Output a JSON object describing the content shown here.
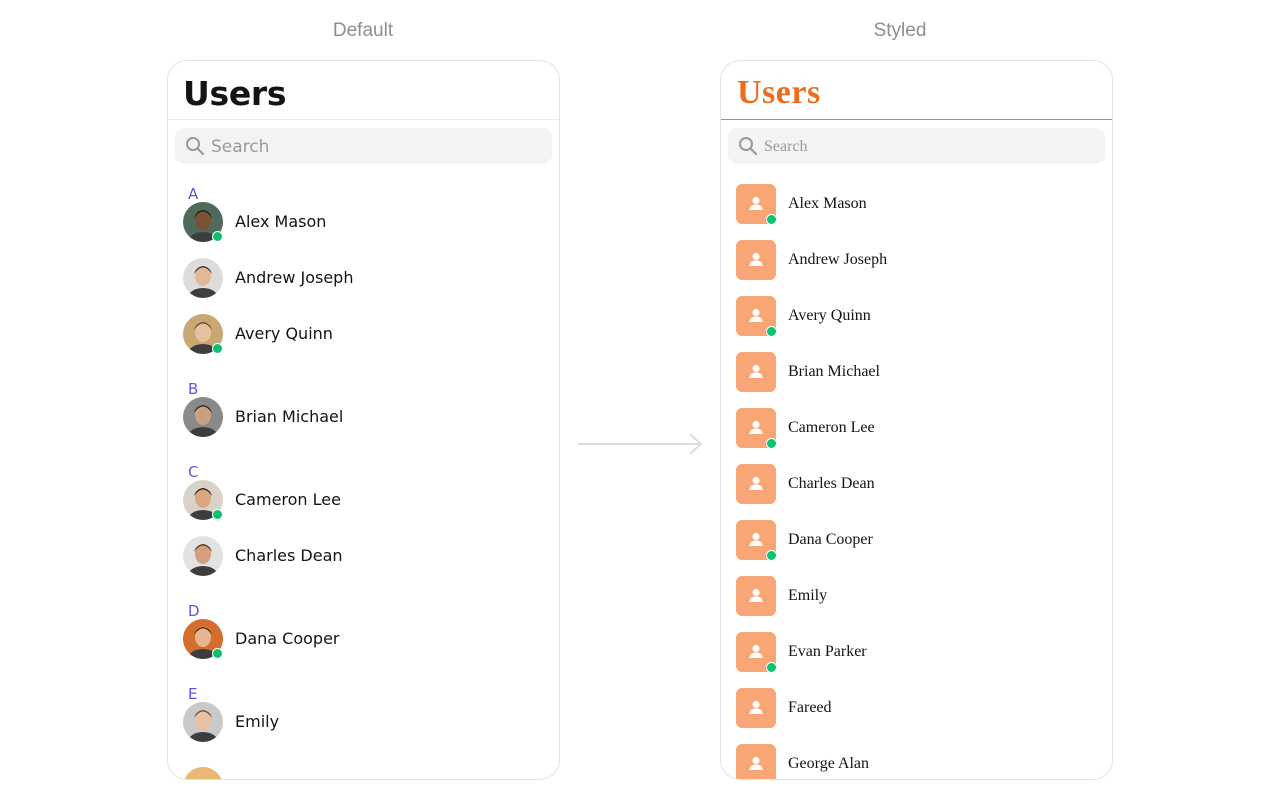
{
  "captions": {
    "default": "Default",
    "styled": "Styled"
  },
  "default_panel": {
    "title": "Users",
    "search_placeholder": "Search",
    "sections": [
      "A",
      "B",
      "C",
      "D",
      "E"
    ],
    "users": [
      {
        "name": "Alex Mason",
        "online": true,
        "skin": "#7a5236",
        "hair": "#2c1d12",
        "bg": "#4d6a5a"
      },
      {
        "name": "Andrew Joseph",
        "online": false,
        "skin": "#e3b897",
        "hair": "#4a3424",
        "bg": "#dcdcdc"
      },
      {
        "name": "Avery Quinn",
        "online": true,
        "skin": "#e8c0a0",
        "hair": "#6a4628",
        "bg": "#c8a772"
      },
      {
        "name": "Brian Michael",
        "online": false,
        "skin": "#caa07e",
        "hair": "#2b2522",
        "bg": "#8a8a8a"
      },
      {
        "name": "Cameron Lee",
        "online": true,
        "skin": "#d9a77f",
        "hair": "#2f2520",
        "bg": "#d8d2c8"
      },
      {
        "name": "Charles Dean",
        "online": false,
        "skin": "#d4a07b",
        "hair": "#5a3a22",
        "bg": "#e2e2e2"
      },
      {
        "name": "Dana Cooper",
        "online": true,
        "skin": "#e6b690",
        "hair": "#5a3218",
        "bg": "#d46e2e"
      },
      {
        "name": "Emily",
        "online": false,
        "skin": "#eac0a2",
        "hair": "#7a4c2c",
        "bg": "#c9c9c9"
      }
    ]
  },
  "styled_panel": {
    "title": "Users",
    "search_placeholder": "Search",
    "users": [
      {
        "name": "Alex Mason",
        "online": true
      },
      {
        "name": "Andrew Joseph",
        "online": false
      },
      {
        "name": "Avery Quinn",
        "online": true
      },
      {
        "name": "Brian Michael",
        "online": false
      },
      {
        "name": "Cameron Lee",
        "online": true
      },
      {
        "name": "Charles Dean",
        "online": false
      },
      {
        "name": "Dana Cooper",
        "online": true
      },
      {
        "name": "Emily",
        "online": false
      },
      {
        "name": "Evan Parker",
        "online": true
      },
      {
        "name": "Fareed",
        "online": false
      },
      {
        "name": "George Alan",
        "online": false
      }
    ]
  },
  "colors": {
    "accent": "#6851d6",
    "online": "#09c26e",
    "styled_title": "#ef6c1e",
    "styled_avatar": "#f8a675",
    "styled_divider": "#c48b2a"
  }
}
